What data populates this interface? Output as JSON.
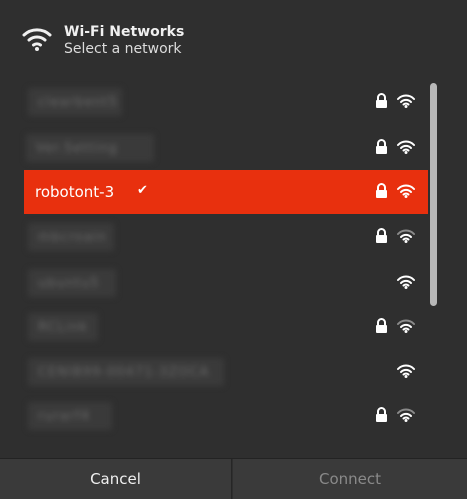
{
  "header": {
    "title": "Wi-Fi Networks",
    "subtitle": "Select a network",
    "icon": "wifi-icon"
  },
  "networks": [
    {
      "ssid": "clearbent5",
      "selected": false,
      "secured": true,
      "signal": 4,
      "blurred": true
    },
    {
      "ssid": "Ver.Setting",
      "selected": false,
      "secured": true,
      "signal": 4,
      "blurred": true
    },
    {
      "ssid": "robotont-3",
      "selected": true,
      "secured": true,
      "signal": 4,
      "blurred": false
    },
    {
      "ssid": "mbcroain",
      "selected": false,
      "secured": true,
      "signal": 2,
      "blurred": true
    },
    {
      "ssid": "ubuntu5",
      "selected": false,
      "secured": false,
      "signal": 3,
      "blurred": true
    },
    {
      "ssid": "RCLink",
      "selected": false,
      "secured": true,
      "signal": 2,
      "blurred": true
    },
    {
      "ssid": "CENIB99-00471-3ZOCA",
      "selected": false,
      "secured": false,
      "signal": 3,
      "blurred": true
    },
    {
      "ssid": "rurarf4",
      "selected": false,
      "secured": true,
      "signal": 2,
      "blurred": true
    }
  ],
  "checkmark": "✔",
  "footer": {
    "cancel_label": "Cancel",
    "connect_label": "Connect"
  },
  "colors": {
    "accent": "#e8300e",
    "background": "#2f2f2f",
    "signal_strong": "#ffffff",
    "signal_weak": "#8a8a8a"
  }
}
